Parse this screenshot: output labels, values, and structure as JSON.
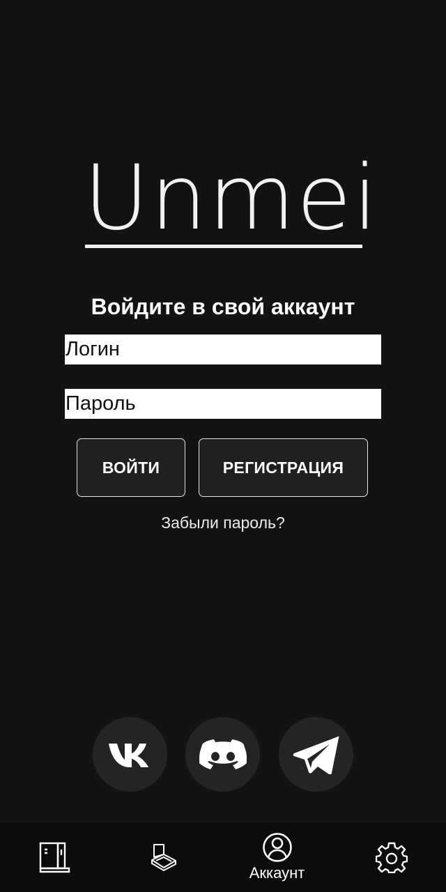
{
  "logo": {
    "text": "Unmei"
  },
  "login": {
    "title": "Войдите в свой аккаунт",
    "login_placeholder": "Логин",
    "password_placeholder": "Пароль",
    "login_button": "ВОЙТИ",
    "register_button": "РЕГИСТРАЦИЯ",
    "forgot_link": "Забыли пароль?"
  },
  "social": [
    {
      "icon": "vk-icon"
    },
    {
      "icon": "discord-icon"
    },
    {
      "icon": "telegram-icon"
    }
  ],
  "bottom_nav": {
    "items": [
      {
        "icon": "library-icon",
        "label": ""
      },
      {
        "icon": "reader-icon",
        "label": ""
      },
      {
        "icon": "account-icon",
        "label": "Аккаунт",
        "active": true
      },
      {
        "icon": "gear-icon",
        "label": ""
      }
    ]
  },
  "colors": {
    "background": "#131313",
    "nav_background": "#0c0c0c",
    "button_background": "#202020",
    "social_background": "#242424",
    "text": "#ffffff"
  }
}
